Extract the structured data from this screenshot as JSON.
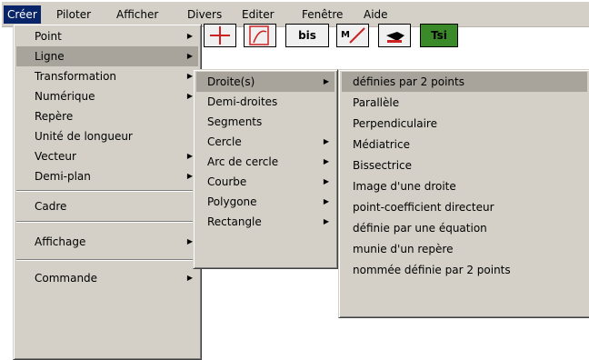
{
  "menubar": [
    "Créer",
    "Piloter",
    "Afficher",
    "Divers",
    "Editer",
    "Fenêtre",
    "Aide"
  ],
  "toolbar": {
    "bis_label": "bis",
    "ts_label": "Tsi"
  },
  "menu_creer": {
    "items": [
      "Point",
      "Ligne",
      "Transformation",
      "Numérique",
      "Repère",
      "Unité de longueur",
      "Vecteur",
      "Demi-plan"
    ],
    "cadre": "Cadre",
    "affichage": "Affichage",
    "commande": "Commande"
  },
  "menu_ligne": {
    "items": [
      "Droite(s)",
      "Demi-droites",
      "Segments",
      "Cercle",
      "Arc de cercle",
      "Courbe",
      "Polygone",
      "Rectangle"
    ]
  },
  "menu_droites": {
    "items": [
      "définies par 2 points",
      "Parallèle",
      "Perpendiculaire",
      "Médiatrice",
      "Bissectrice",
      "Image d'une droite",
      "point-coefficient directeur",
      "définie par une équation",
      "munie d'un repère",
      "nommée définie par 2 points"
    ]
  },
  "colors": {
    "menu_bg": "#d4d0c8",
    "highlight": "#0a246a"
  }
}
